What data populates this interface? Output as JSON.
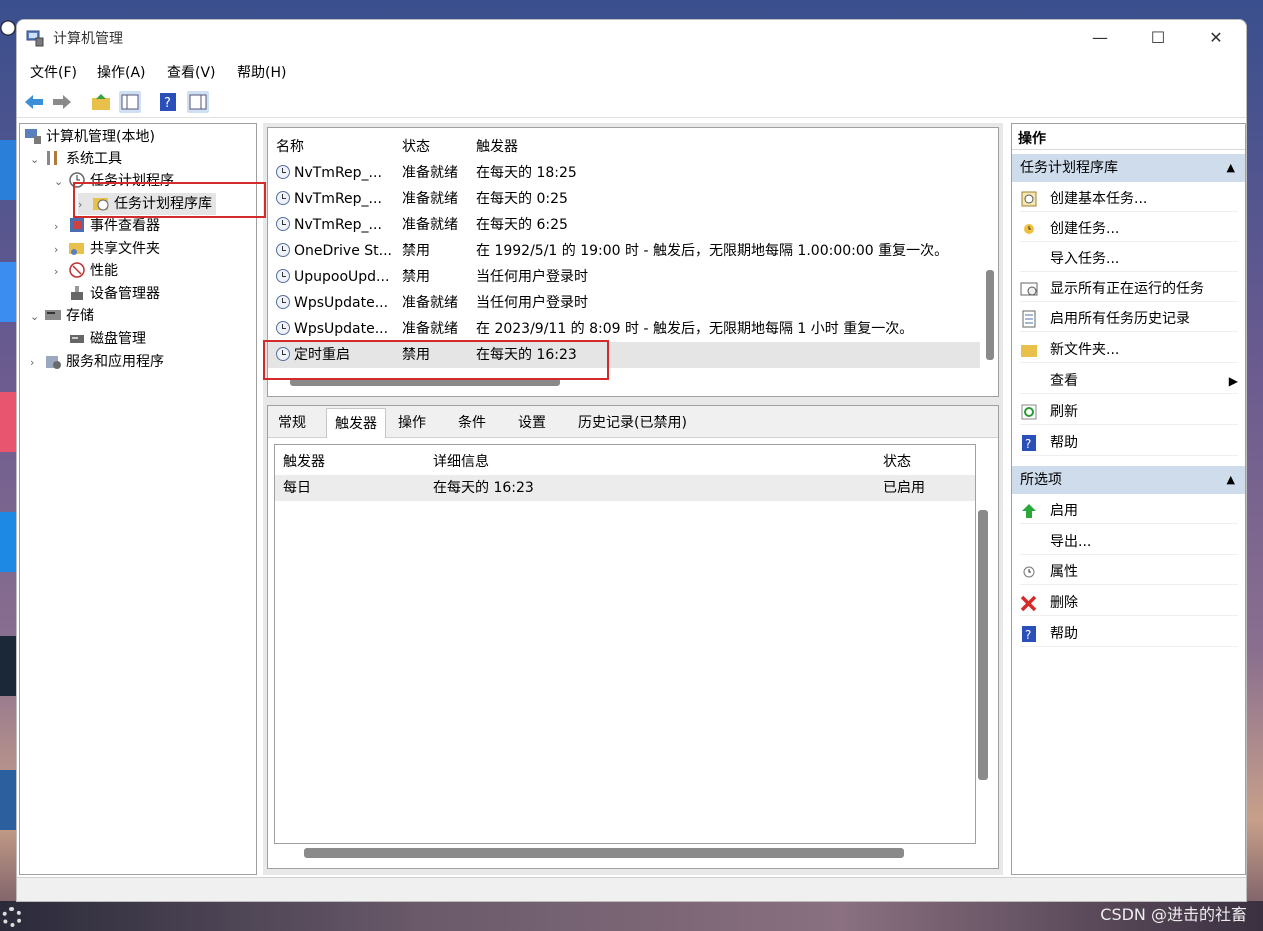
{
  "window": {
    "title": "计算机管理",
    "controls": {
      "minimize": "—",
      "maximize": "☐",
      "close": "✕"
    }
  },
  "menu": [
    "文件(F)",
    "操作(A)",
    "查看(V)",
    "帮助(H)"
  ],
  "toolbar": [
    "back-arrow-icon",
    "forward-arrow-icon",
    "up-folder-icon",
    "show-tree-icon",
    "help-icon",
    "show-action-pane-icon"
  ],
  "tree": {
    "root": "计算机管理(本地)",
    "system_tools": "系统工具",
    "task_scheduler": "任务计划程序",
    "task_library": "任务计划程序库",
    "event_viewer": "事件查看器",
    "shared_folders": "共享文件夹",
    "performance": "性能",
    "device_manager": "设备管理器",
    "storage": "存储",
    "disk_management": "磁盘管理",
    "services": "服务和应用程序"
  },
  "task_list": {
    "headers": {
      "name": "名称",
      "status": "状态",
      "trigger": "触发器"
    },
    "rows": [
      {
        "name": "NvTmRep_...",
        "status": "准备就绪",
        "trigger": "在每天的 18:25"
      },
      {
        "name": "NvTmRep_...",
        "status": "准备就绪",
        "trigger": "在每天的 0:25"
      },
      {
        "name": "NvTmRep_...",
        "status": "准备就绪",
        "trigger": "在每天的 6:25"
      },
      {
        "name": "OneDrive St...",
        "status": "禁用",
        "trigger": "在 1992/5/1 的 19:00 时 - 触发后，无限期地每隔 1.00:00:00 重复一次。"
      },
      {
        "name": "UpupooUpd...",
        "status": "禁用",
        "trigger": "当任何用户登录时"
      },
      {
        "name": "WpsUpdate...",
        "status": "准备就绪",
        "trigger": "当任何用户登录时"
      },
      {
        "name": "WpsUpdate...",
        "status": "准备就绪",
        "trigger": "在 2023/9/11 的 8:09 时 - 触发后，无限期地每隔 1 小时 重复一次。"
      },
      {
        "name": "定时重启",
        "status": "禁用",
        "trigger": "在每天的 16:23"
      }
    ]
  },
  "detail_tabs": [
    "常规",
    "触发器",
    "操作",
    "条件",
    "设置",
    "历史记录(已禁用)"
  ],
  "trigger_grid": {
    "headers": {
      "trigger": "触发器",
      "details": "详细信息",
      "status": "状态"
    },
    "rows": [
      {
        "trigger": "每日",
        "details": "在每天的 16:23",
        "status": "已启用"
      }
    ]
  },
  "actions": {
    "title": "操作",
    "section1": {
      "title": "任务计划程序库",
      "items": [
        "创建基本任务...",
        "创建任务...",
        "导入任务...",
        "显示所有正在运行的任务",
        "启用所有任务历史记录",
        "新文件夹...",
        "查看",
        "刷新",
        "帮助"
      ]
    },
    "section2": {
      "title": "所选项",
      "items": [
        "启用",
        "导出...",
        "属性",
        "删除",
        "帮助"
      ]
    }
  },
  "watermark": "CSDN @进击的社畜",
  "colors": {
    "accent_header": "#cfdcec",
    "highlight_box": "#d32b2b",
    "selected_row": "#e5e5e5"
  }
}
